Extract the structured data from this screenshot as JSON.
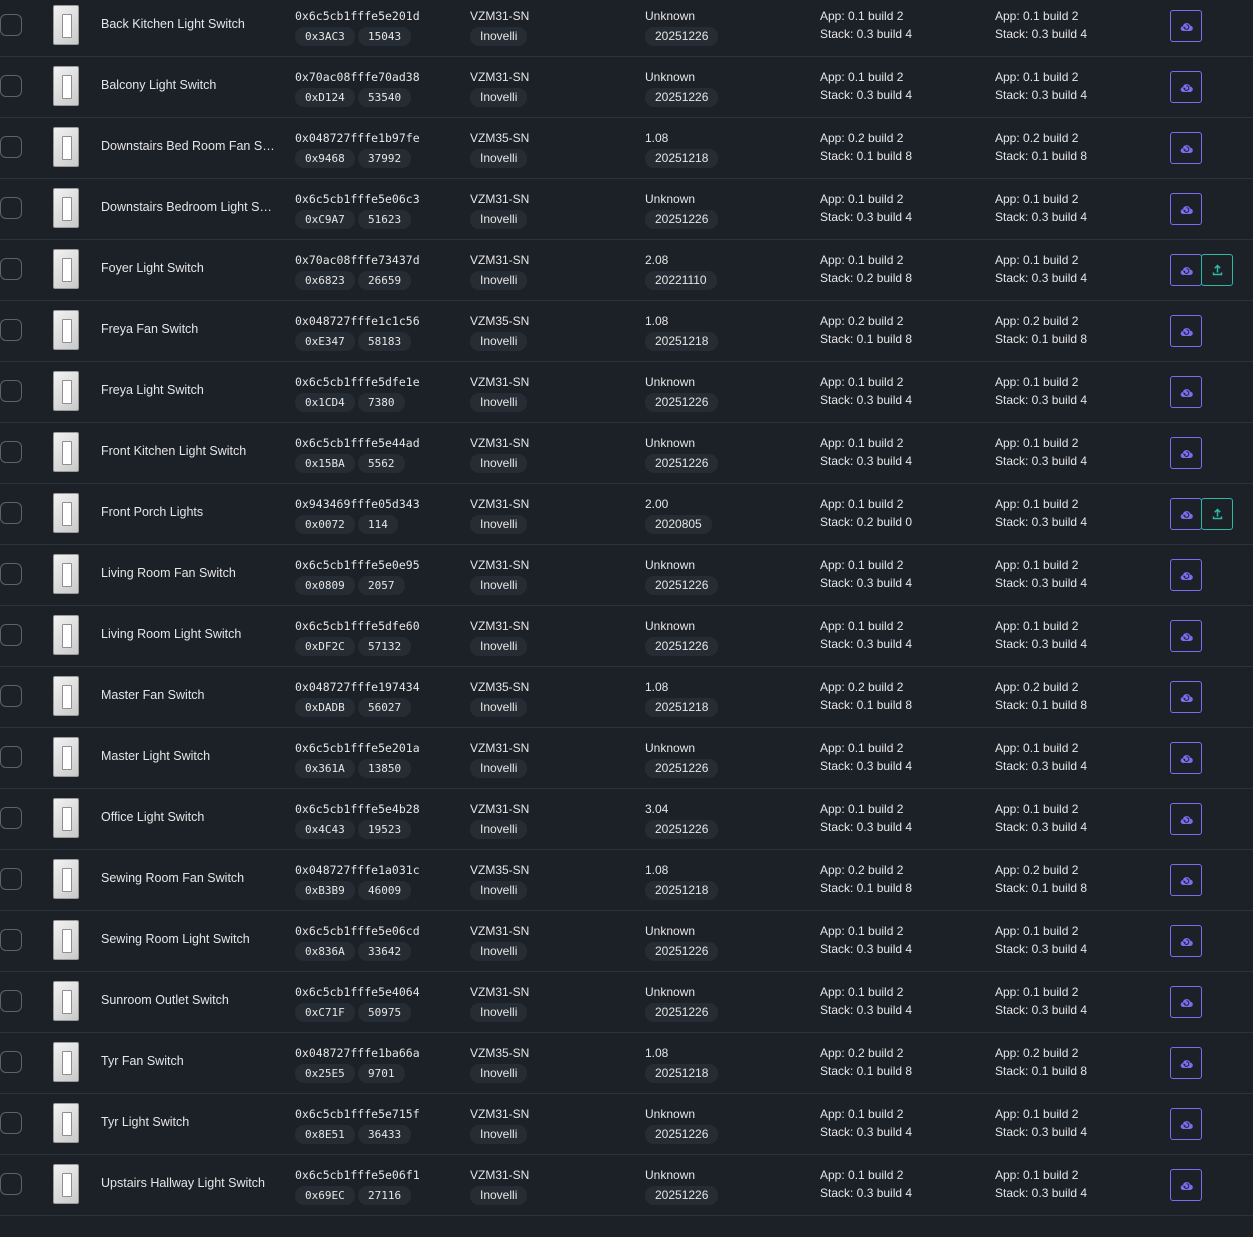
{
  "colors": {
    "background": "#1c2128",
    "row_divider": "#2d333b",
    "chip_bg": "#262c33",
    "check_button": "#7c6cf0",
    "ota_button": "#2fb9a3"
  },
  "icons": {
    "check_update": "cloud-sync-icon",
    "start_ota": "upload-icon",
    "device_image": "light-switch-icon"
  },
  "devices": [
    {
      "name": "Back Kitchen Light Switch",
      "ieee": "0x6c5cb1fffe5e201d",
      "nwk": "0x3AC3",
      "pid": "15043",
      "model": "VZM31-SN",
      "vendor": "Inovelli",
      "fw": "Unknown",
      "fw_date": "20251226",
      "app": "App: 0.1 build 2",
      "stack": "Stack: 0.3 build 4",
      "avail_app": "App: 0.1 build 2",
      "avail_stack": "Stack: 0.3 build 4",
      "ota": false
    },
    {
      "name": "Balcony Light Switch",
      "ieee": "0x70ac08fffe70ad38",
      "nwk": "0xD124",
      "pid": "53540",
      "model": "VZM31-SN",
      "vendor": "Inovelli",
      "fw": "Unknown",
      "fw_date": "20251226",
      "app": "App: 0.1 build 2",
      "stack": "Stack: 0.3 build 4",
      "avail_app": "App: 0.1 build 2",
      "avail_stack": "Stack: 0.3 build 4",
      "ota": false
    },
    {
      "name": "Downstairs Bed Room Fan Swi...",
      "ieee": "0x048727fffe1b97fe",
      "nwk": "0x9468",
      "pid": "37992",
      "model": "VZM35-SN",
      "vendor": "Inovelli",
      "fw": "1.08",
      "fw_date": "20251218",
      "app": "App: 0.2 build 2",
      "stack": "Stack: 0.1 build 8",
      "avail_app": "App: 0.2 build 2",
      "avail_stack": "Stack: 0.1 build 8",
      "ota": false
    },
    {
      "name": "Downstairs Bedroom Light Sw...",
      "ieee": "0x6c5cb1fffe5e06c3",
      "nwk": "0xC9A7",
      "pid": "51623",
      "model": "VZM31-SN",
      "vendor": "Inovelli",
      "fw": "Unknown",
      "fw_date": "20251226",
      "app": "App: 0.1 build 2",
      "stack": "Stack: 0.3 build 4",
      "avail_app": "App: 0.1 build 2",
      "avail_stack": "Stack: 0.3 build 4",
      "ota": false
    },
    {
      "name": "Foyer Light Switch",
      "ieee": "0x70ac08fffe73437d",
      "nwk": "0x6823",
      "pid": "26659",
      "model": "VZM31-SN",
      "vendor": "Inovelli",
      "fw": "2.08",
      "fw_date": "20221110",
      "app": "App: 0.1 build 2",
      "stack": "Stack: 0.2 build 8",
      "avail_app": "App: 0.1 build 2",
      "avail_stack": "Stack: 0.3 build 4",
      "ota": true
    },
    {
      "name": "Freya Fan Switch",
      "ieee": "0x048727fffe1c1c56",
      "nwk": "0xE347",
      "pid": "58183",
      "model": "VZM35-SN",
      "vendor": "Inovelli",
      "fw": "1.08",
      "fw_date": "20251218",
      "app": "App: 0.2 build 2",
      "stack": "Stack: 0.1 build 8",
      "avail_app": "App: 0.2 build 2",
      "avail_stack": "Stack: 0.1 build 8",
      "ota": false
    },
    {
      "name": "Freya Light Switch",
      "ieee": "0x6c5cb1fffe5dfe1e",
      "nwk": "0x1CD4",
      "pid": "7380",
      "model": "VZM31-SN",
      "vendor": "Inovelli",
      "fw": "Unknown",
      "fw_date": "20251226",
      "app": "App: 0.1 build 2",
      "stack": "Stack: 0.3 build 4",
      "avail_app": "App: 0.1 build 2",
      "avail_stack": "Stack: 0.3 build 4",
      "ota": false
    },
    {
      "name": "Front Kitchen Light Switch",
      "ieee": "0x6c5cb1fffe5e44ad",
      "nwk": "0x15BA",
      "pid": "5562",
      "model": "VZM31-SN",
      "vendor": "Inovelli",
      "fw": "Unknown",
      "fw_date": "20251226",
      "app": "App: 0.1 build 2",
      "stack": "Stack: 0.3 build 4",
      "avail_app": "App: 0.1 build 2",
      "avail_stack": "Stack: 0.3 build 4",
      "ota": false
    },
    {
      "name": "Front Porch Lights",
      "ieee": "0x943469fffe05d343",
      "nwk": "0x0072",
      "pid": "114",
      "model": "VZM31-SN",
      "vendor": "Inovelli",
      "fw": "2.00",
      "fw_date": "2020805",
      "app": "App: 0.1 build 2",
      "stack": "Stack: 0.2 build 0",
      "avail_app": "App: 0.1 build 2",
      "avail_stack": "Stack: 0.3 build 4",
      "ota": true
    },
    {
      "name": "Living Room Fan Switch",
      "ieee": "0x6c5cb1fffe5e0e95",
      "nwk": "0x0809",
      "pid": "2057",
      "model": "VZM31-SN",
      "vendor": "Inovelli",
      "fw": "Unknown",
      "fw_date": "20251226",
      "app": "App: 0.1 build 2",
      "stack": "Stack: 0.3 build 4",
      "avail_app": "App: 0.1 build 2",
      "avail_stack": "Stack: 0.3 build 4",
      "ota": false
    },
    {
      "name": "Living Room Light Switch",
      "ieee": "0x6c5cb1fffe5dfe60",
      "nwk": "0xDF2C",
      "pid": "57132",
      "model": "VZM31-SN",
      "vendor": "Inovelli",
      "fw": "Unknown",
      "fw_date": "20251226",
      "app": "App: 0.1 build 2",
      "stack": "Stack: 0.3 build 4",
      "avail_app": "App: 0.1 build 2",
      "avail_stack": "Stack: 0.3 build 4",
      "ota": false
    },
    {
      "name": "Master Fan Switch",
      "ieee": "0x048727fffe197434",
      "nwk": "0xDADB",
      "pid": "56027",
      "model": "VZM35-SN",
      "vendor": "Inovelli",
      "fw": "1.08",
      "fw_date": "20251218",
      "app": "App: 0.2 build 2",
      "stack": "Stack: 0.1 build 8",
      "avail_app": "App: 0.2 build 2",
      "avail_stack": "Stack: 0.1 build 8",
      "ota": false
    },
    {
      "name": "Master Light Switch",
      "ieee": "0x6c5cb1fffe5e201a",
      "nwk": "0x361A",
      "pid": "13850",
      "model": "VZM31-SN",
      "vendor": "Inovelli",
      "fw": "Unknown",
      "fw_date": "20251226",
      "app": "App: 0.1 build 2",
      "stack": "Stack: 0.3 build 4",
      "avail_app": "App: 0.1 build 2",
      "avail_stack": "Stack: 0.3 build 4",
      "ota": false
    },
    {
      "name": "Office Light Switch",
      "ieee": "0x6c5cb1fffe5e4b28",
      "nwk": "0x4C43",
      "pid": "19523",
      "model": "VZM31-SN",
      "vendor": "Inovelli",
      "fw": "3.04",
      "fw_date": "20251226",
      "app": "App: 0.1 build 2",
      "stack": "Stack: 0.3 build 4",
      "avail_app": "App: 0.1 build 2",
      "avail_stack": "Stack: 0.3 build 4",
      "ota": false
    },
    {
      "name": "Sewing Room Fan Switch",
      "ieee": "0x048727fffe1a031c",
      "nwk": "0xB3B9",
      "pid": "46009",
      "model": "VZM35-SN",
      "vendor": "Inovelli",
      "fw": "1.08",
      "fw_date": "20251218",
      "app": "App: 0.2 build 2",
      "stack": "Stack: 0.1 build 8",
      "avail_app": "App: 0.2 build 2",
      "avail_stack": "Stack: 0.1 build 8",
      "ota": false
    },
    {
      "name": "Sewing Room Light Switch",
      "ieee": "0x6c5cb1fffe5e06cd",
      "nwk": "0x836A",
      "pid": "33642",
      "model": "VZM31-SN",
      "vendor": "Inovelli",
      "fw": "Unknown",
      "fw_date": "20251226",
      "app": "App: 0.1 build 2",
      "stack": "Stack: 0.3 build 4",
      "avail_app": "App: 0.1 build 2",
      "avail_stack": "Stack: 0.3 build 4",
      "ota": false
    },
    {
      "name": "Sunroom Outlet Switch",
      "ieee": "0x6c5cb1fffe5e4064",
      "nwk": "0xC71F",
      "pid": "50975",
      "model": "VZM31-SN",
      "vendor": "Inovelli",
      "fw": "Unknown",
      "fw_date": "20251226",
      "app": "App: 0.1 build 2",
      "stack": "Stack: 0.3 build 4",
      "avail_app": "App: 0.1 build 2",
      "avail_stack": "Stack: 0.3 build 4",
      "ota": false
    },
    {
      "name": "Tyr Fan Switch",
      "ieee": "0x048727fffe1ba66a",
      "nwk": "0x25E5",
      "pid": "9701",
      "model": "VZM35-SN",
      "vendor": "Inovelli",
      "fw": "1.08",
      "fw_date": "20251218",
      "app": "App: 0.2 build 2",
      "stack": "Stack: 0.1 build 8",
      "avail_app": "App: 0.2 build 2",
      "avail_stack": "Stack: 0.1 build 8",
      "ota": false
    },
    {
      "name": "Tyr Light Switch",
      "ieee": "0x6c5cb1fffe5e715f",
      "nwk": "0x8E51",
      "pid": "36433",
      "model": "VZM31-SN",
      "vendor": "Inovelli",
      "fw": "Unknown",
      "fw_date": "20251226",
      "app": "App: 0.1 build 2",
      "stack": "Stack: 0.3 build 4",
      "avail_app": "App: 0.1 build 2",
      "avail_stack": "Stack: 0.3 build 4",
      "ota": false
    },
    {
      "name": "Upstairs Hallway Light Switch",
      "ieee": "0x6c5cb1fffe5e06f1",
      "nwk": "0x69EC",
      "pid": "27116",
      "model": "VZM31-SN",
      "vendor": "Inovelli",
      "fw": "Unknown",
      "fw_date": "20251226",
      "app": "App: 0.1 build 2",
      "stack": "Stack: 0.3 build 4",
      "avail_app": "App: 0.1 build 2",
      "avail_stack": "Stack: 0.3 build 4",
      "ota": false
    }
  ]
}
